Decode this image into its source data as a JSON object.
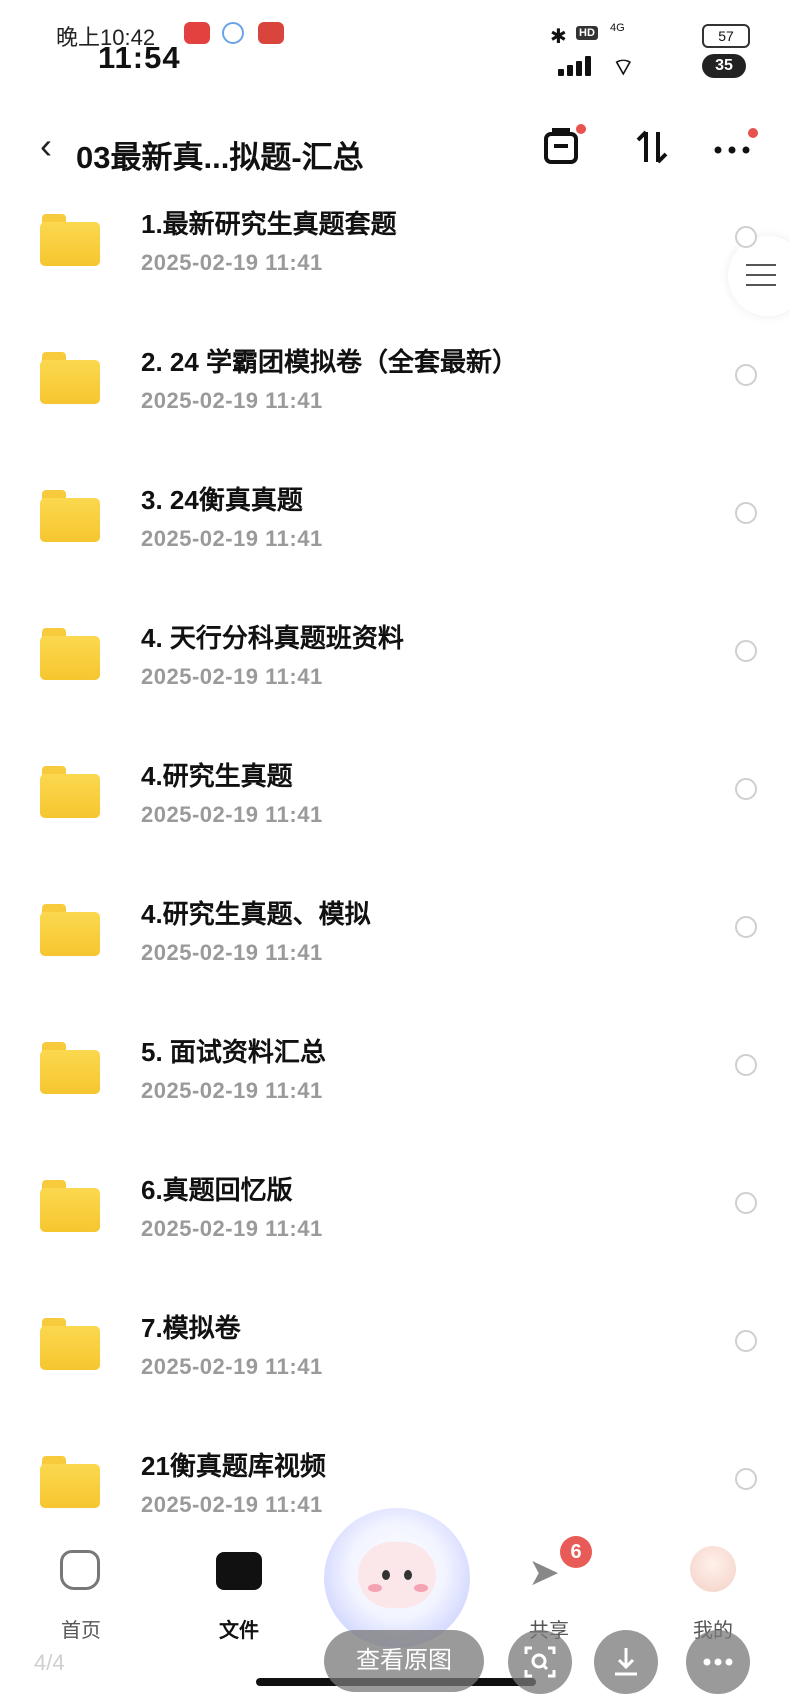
{
  "status_bar": {
    "time_small": "晚上10:42",
    "time_large": "11:54",
    "hd": "HD",
    "network": "4G",
    "battery": "57",
    "battery2": "35"
  },
  "header": {
    "title": "03最新真...拟题-汇总"
  },
  "files": [
    {
      "name": "1.最新研究生真题套题",
      "date": "2025-02-19 11:41"
    },
    {
      "name": "2. 24 学霸团模拟卷（全套最新）",
      "date": "2025-02-19 11:41"
    },
    {
      "name": "3. 24衡真真题",
      "date": "2025-02-19 11:41"
    },
    {
      "name": "4. 天行分科真题班资料",
      "date": "2025-02-19 11:41"
    },
    {
      "name": "4.研究生真题",
      "date": "2025-02-19 11:41"
    },
    {
      "name": "4.研究生真题、模拟",
      "date": "2025-02-19 11:41"
    },
    {
      "name": "5. 面试资料汇总",
      "date": "2025-02-19 11:41"
    },
    {
      "name": "6.真题回忆版",
      "date": "2025-02-19 11:41"
    },
    {
      "name": "7.模拟卷",
      "date": "2025-02-19 11:41"
    },
    {
      "name": "21衡真题库视频",
      "date": "2025-02-19 11:41"
    }
  ],
  "bottom_nav": {
    "home": "首页",
    "files": "文件",
    "share": "共享",
    "share_badge": "6",
    "me": "我的"
  },
  "overlay": {
    "page_indicator": "4/4",
    "view_original": "查看原图"
  },
  "colors": {
    "folder": "#f6c62f",
    "badge": "#e95b56"
  }
}
